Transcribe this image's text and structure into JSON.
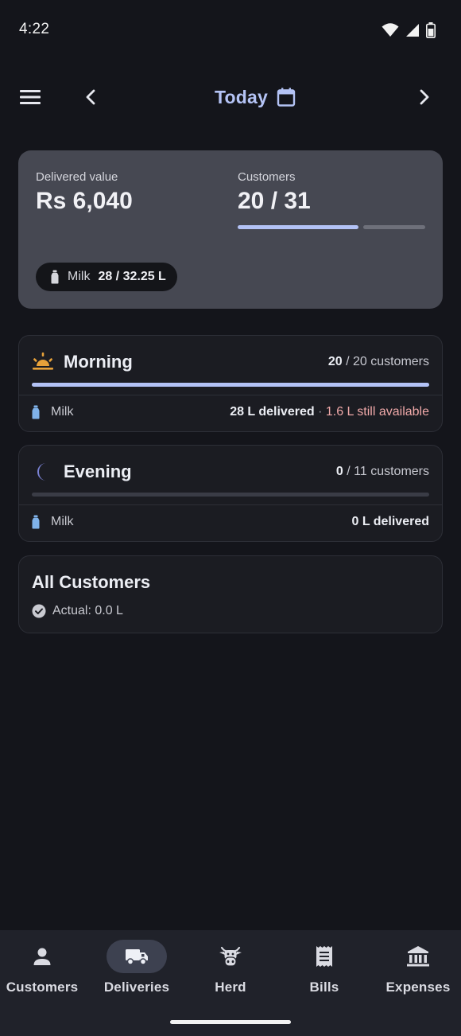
{
  "status_bar": {
    "time": "4:22"
  },
  "header": {
    "date_label": "Today",
    "icons": {
      "menu": "menu-icon",
      "prev": "chevron-left-icon",
      "next": "chevron-right-icon",
      "calendar": "calendar-icon"
    }
  },
  "summary": {
    "delivered_label": "Delivered value",
    "delivered_value": "Rs 6,040",
    "customers_label": "Customers",
    "customers_value": "20 / 31",
    "customers_progress": 0.645,
    "chip_label": "Milk",
    "chip_value": "28 / 32.25 L"
  },
  "morning": {
    "title": "Morning",
    "done": "20",
    "total_text": " / 20 customers",
    "progress": 1.0,
    "product": "Milk",
    "delivered": "28 L delivered",
    "separator": " · ",
    "available": "1.6 L still available"
  },
  "evening": {
    "title": "Evening",
    "done": "0",
    "total_text": " / 11 customers",
    "progress": 0.0,
    "product": "Milk",
    "delivered": "0 L delivered"
  },
  "all_customers": {
    "title": "All Customers",
    "actual": "Actual: 0.0 L"
  },
  "nav": [
    {
      "label": "Customers",
      "icon": "person-icon",
      "active": false
    },
    {
      "label": "Deliveries",
      "icon": "truck-icon",
      "active": true
    },
    {
      "label": "Herd",
      "icon": "cow-icon",
      "active": false
    },
    {
      "label": "Bills",
      "icon": "receipt-icon",
      "active": false
    },
    {
      "label": "Expenses",
      "icon": "bank-icon",
      "active": false
    }
  ],
  "colors": {
    "accent": "#b4c3f5",
    "background": "#14151b",
    "summary_card": "#464852",
    "available_text": "#f0a9a9",
    "milk_bottle": "#7fb2ea",
    "sunrise": "#e8a23a",
    "moon": "#7b83d6"
  }
}
